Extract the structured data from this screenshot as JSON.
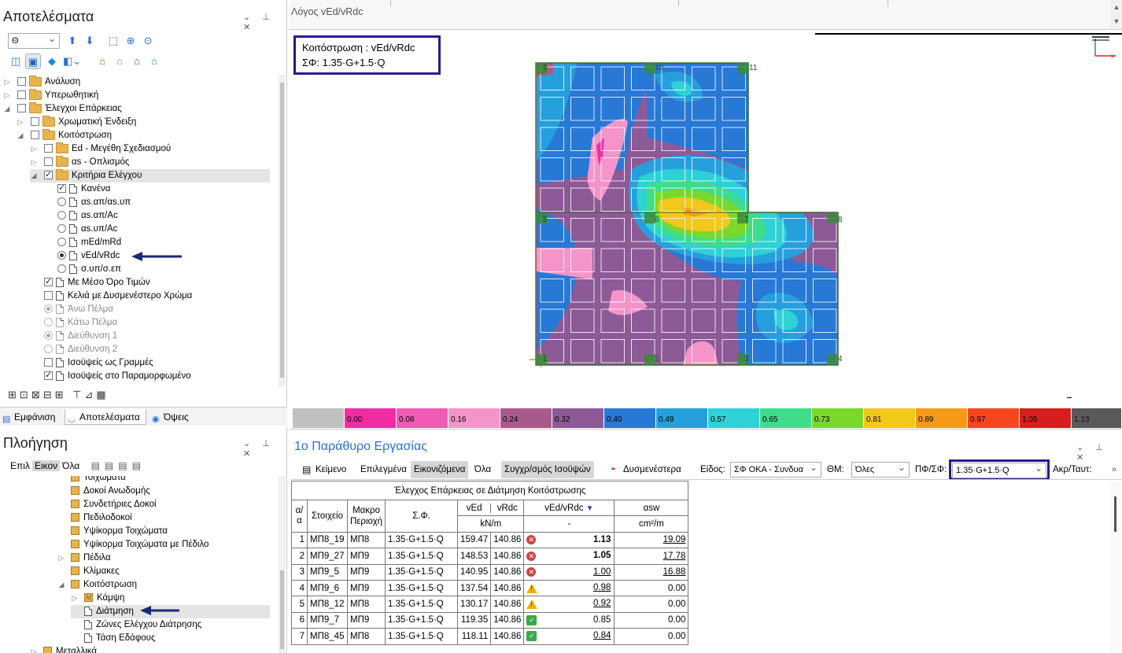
{
  "results_panel": {
    "title": "Αποτελέσματα",
    "floor_value": "Θ",
    "tree": [
      {
        "label": "Ανάλυση"
      },
      {
        "label": "Υπερωθητική"
      },
      {
        "label": "Έλεγχοι Επάρκειας"
      },
      {
        "label": "Χρωματική Ένδειξη"
      },
      {
        "label": "Κοιτόστρωση"
      },
      {
        "label": "Ed - Μεγέθη Σχεδιασμού"
      },
      {
        "label": "αs - Οπλισμός"
      },
      {
        "label": "Κριτήρια Ελέγχου"
      },
      {
        "label": "Κανένα"
      },
      {
        "label": "αs.απ/αs.υπ"
      },
      {
        "label": "αs.απ/Ac"
      },
      {
        "label": "αs.υπ/Ac"
      },
      {
        "label": "mEd/mRd"
      },
      {
        "label": "vEd/vRdc"
      },
      {
        "label": "σ.υπ/σ.επ"
      },
      {
        "label": "Με Μέσο Όρο Τιμών"
      },
      {
        "label": "Κελιά με Δυσμενέστερο Χρώμα"
      },
      {
        "label": "Άνω Πέλμα"
      },
      {
        "label": "Κάτω Πέλμα"
      },
      {
        "label": "Διεύθυνση 1"
      },
      {
        "label": "Διεύθυνση 2"
      },
      {
        "label": "Ισοϋψείς ως Γραμμές"
      },
      {
        "label": "Ισοϋψείς στο Παραμορφωμένο"
      }
    ],
    "tabs": [
      "Εμφάνιση",
      "Αποτελέσματα",
      "Όψεις"
    ]
  },
  "nav_panel": {
    "title": "Πλοήγηση",
    "filters": [
      "Επιλ",
      "Εικον",
      "Όλα"
    ],
    "tree": [
      {
        "label": "Τοιχώματα"
      },
      {
        "label": "Δοκοί Ανωδομής"
      },
      {
        "label": "Συνδετήριες Δοκοί"
      },
      {
        "label": "Πεδιλοδοκοί"
      },
      {
        "label": "Υψίκορμα Τοιχώματα"
      },
      {
        "label": "Υψίκορμα Τοιχώματα με Πέδιλο"
      },
      {
        "label": "Πέδιλα"
      },
      {
        "label": "Κλίμακες"
      },
      {
        "label": "Κοιτόστρωση"
      },
      {
        "label": "Κάμψη"
      },
      {
        "label": "Διάτμηση"
      },
      {
        "label": "Ζώνες Ελέγχου Διάτρησης"
      },
      {
        "label": "Τάση Εδάφους"
      },
      {
        "label": "Μεταλλικά"
      }
    ]
  },
  "view": {
    "tab_title": "Λόγος vEd/vRdc",
    "info_line1": "Κοιτόστρωση : vEd/vRdc",
    "info_line2": "ΣΦ:   1.35·G+1.5·Q",
    "node_labels": [
      "9",
      "10",
      "11",
      "5",
      "6",
      "7",
      "8",
      "1",
      "2",
      "3",
      "4"
    ],
    "legend": [
      {
        "value": "",
        "color": "#c0c0c0"
      },
      {
        "value": "0.00",
        "color": "#f02ca4"
      },
      {
        "value": "0.08",
        "color": "#f05bb6"
      },
      {
        "value": "0.16",
        "color": "#f594c9"
      },
      {
        "value": "0.24",
        "color": "#a95a8d"
      },
      {
        "value": "0.32",
        "color": "#8d5a97"
      },
      {
        "value": "0.40",
        "color": "#2878d6"
      },
      {
        "value": "0.49",
        "color": "#25a0dd"
      },
      {
        "value": "0.57",
        "color": "#2ed1d6"
      },
      {
        "value": "0.65",
        "color": "#3fdc8c"
      },
      {
        "value": "0.73",
        "color": "#7ad82c"
      },
      {
        "value": "0.81",
        "color": "#f2c81a"
      },
      {
        "value": "0.89",
        "color": "#f59a14"
      },
      {
        "value": "0.97",
        "color": "#f5461e"
      },
      {
        "value": "1.05",
        "color": "#d71e1e"
      },
      {
        "value": "1.13",
        "color": "#5a5a5a"
      }
    ]
  },
  "work_window": {
    "title": "1ο Παράθυρο Εργασίας",
    "toolbar": {
      "text_btn": "Κείμενο",
      "selected_btn": "Επιλεγμένα",
      "displayed_btn": "Εικονιζόμενα",
      "all_btn": "Όλα",
      "sync_btn": "Συγχρ/σμός Ισοϋψών",
      "worst_btn": "Δυσμενέστερα",
      "type_label": "Είδος:",
      "type_value": "ΣΦ ΟΚΑ - Συνδυα",
      "tm_label": "ΘΜ:",
      "tm_value": "Όλες",
      "pf_label": "ΠΦ/ΣΦ:",
      "pf_value": "1.35·G+1.5·Q",
      "extra_label": "Ακρ/Ταυτ:"
    },
    "table": {
      "title": "Έλεγχος Επάρκειας σε Διάτμηση Κοιτόστρωσης",
      "headers": {
        "aa": "α/α",
        "element": "Στοιχείο",
        "macro": "Μακρο Περιοχή",
        "combo": "Σ.Φ.",
        "ved": "vEd",
        "vrd": "vRdc",
        "ratio": "vEd/vRdc",
        "asw": "αsw",
        "unit_v": "kN/m",
        "unit_ratio": "-",
        "unit_asw": "cm²/m"
      },
      "rows": [
        {
          "aa": "1",
          "element": "ΜΠ8_19",
          "macro": "ΜΠ8",
          "combo": "1.35·G+1.5·Q",
          "ved": "159.47",
          "vrd": "140.86",
          "status": "fail",
          "ratio": "1.13",
          "asw": "19.09"
        },
        {
          "aa": "2",
          "element": "ΜΠ9_27",
          "macro": "ΜΠ9",
          "combo": "1.35·G+1.5·Q",
          "ved": "148.53",
          "vrd": "140.86",
          "status": "fail",
          "ratio": "1.05",
          "asw": "17.78"
        },
        {
          "aa": "3",
          "element": "ΜΠ9_5",
          "macro": "ΜΠ9",
          "combo": "1.35·G+1.5·Q",
          "ved": "140.95",
          "vrd": "140.86",
          "status": "fail",
          "ratio": "1.00",
          "asw": "16.88"
        },
        {
          "aa": "4",
          "element": "ΜΠ9_6",
          "macro": "ΜΠ9",
          "combo": "1.35·G+1.5·Q",
          "ved": "137.54",
          "vrd": "140.86",
          "status": "warn",
          "ratio": "0.98",
          "asw": "0.00"
        },
        {
          "aa": "5",
          "element": "ΜΠ8_12",
          "macro": "ΜΠ8",
          "combo": "1.35·G+1.5·Q",
          "ved": "130.17",
          "vrd": "140.86",
          "status": "warn",
          "ratio": "0.92",
          "asw": "0.00"
        },
        {
          "aa": "6",
          "element": "ΜΠ9_7",
          "macro": "ΜΠ9",
          "combo": "1.35·G+1.5·Q",
          "ved": "119.35",
          "vrd": "140.86",
          "status": "ok",
          "ratio": "0.85",
          "asw": "0.00"
        },
        {
          "aa": "7",
          "element": "ΜΠ8_45",
          "macro": "ΜΠ8",
          "combo": "1.35·G+1.5·Q",
          "ved": "118.11",
          "vrd": "140.86",
          "status": "ok",
          "ratio": "0.84",
          "asw": "0.00"
        }
      ]
    }
  },
  "colors": {
    "accent_frame": "#2a1a8c",
    "arrow": "#1a2a78"
  }
}
